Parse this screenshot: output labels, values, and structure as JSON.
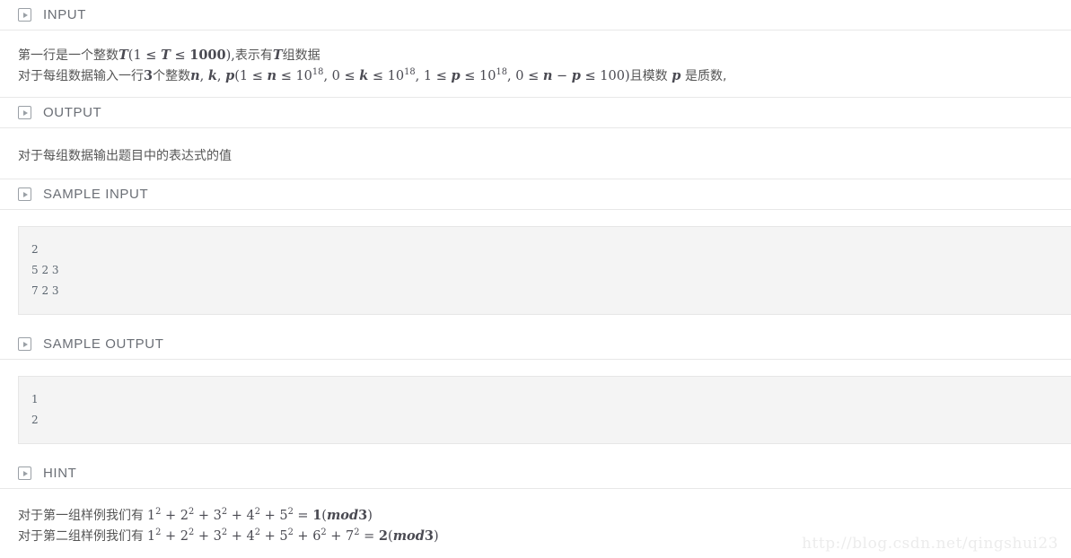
{
  "sections": [
    {
      "id": "input",
      "icon": "play-square-icon",
      "label": "INPUT"
    },
    {
      "id": "output",
      "icon": "play-square-icon",
      "label": "OUTPUT"
    },
    {
      "id": "sample-input",
      "icon": "play-square-icon",
      "label": "SAMPLE INPUT"
    },
    {
      "id": "sample-output",
      "icon": "play-square-icon",
      "label": "SAMPLE OUTPUT"
    },
    {
      "id": "hint",
      "icon": "play-square-icon",
      "label": "HINT"
    }
  ],
  "input": {
    "line1_prefix": "第一行是一个整数",
    "line1_math": "T(1 ≤ T ≤ 1000),",
    "line1_suffix_a": "表示有",
    "line1_var": "T",
    "line1_suffix_b": "组数据",
    "line2_prefix": "对于每组数据输入一行",
    "line2_num": "3",
    "line2_mid": "个整数",
    "line2_math": "n, k, p(1 ≤ n ≤ 10^18, 0 ≤ k ≤ 10^18, 1 ≤ p ≤ 10^18, 0 ≤ n − p ≤ 100)",
    "line2_tail_a": "且模数",
    "line2_tail_var": "p",
    "line2_tail_b": "是质数,"
  },
  "output": {
    "text": "对于每组数据输出题目中的表达式的值"
  },
  "sample_input": {
    "lines": [
      "2",
      "5 2 3",
      "7 2 3"
    ]
  },
  "sample_output": {
    "lines": [
      "1",
      "2"
    ]
  },
  "hint": {
    "line1_prefix": "对于第一组样例我们有",
    "line1_math": "1^2 + 2^2 + 3^2 + 4^2 + 5^2 = 1(mod3)",
    "line2_prefix": "对于第二组样例我们有",
    "line2_math": "1^2 + 2^2 + 3^2 + 4^2 + 5^2 + 6^2 + 7^2 = 2(mod3)"
  },
  "watermark": {
    "text": "http://blog.csdn.net/qingshui23"
  },
  "colors": {
    "page_background": "#ffffff",
    "text": "#555555",
    "header_text": "#6b6f76",
    "icon": "#9aa0a6",
    "divider": "#e8e8e8",
    "code_background": "#f4f4f4",
    "code_border": "#e6e6e6",
    "code_text": "#5c6670",
    "math_text": "#4a4a52",
    "watermark": "#ececec"
  }
}
